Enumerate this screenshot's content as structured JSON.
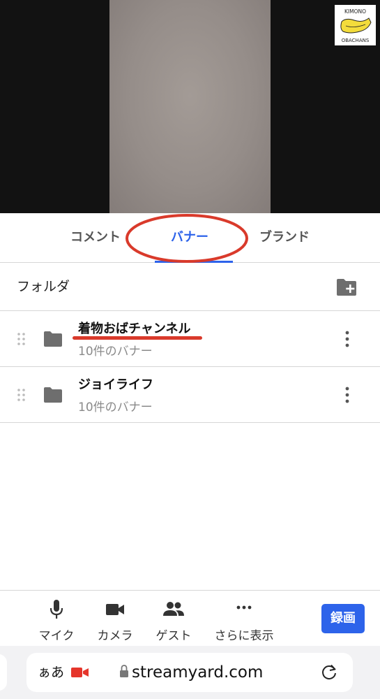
{
  "logo": {
    "line1": "KIMONO",
    "line2": "OBACHANS"
  },
  "tabs": [
    {
      "label": "コメント",
      "active": false
    },
    {
      "label": "バナー",
      "active": true
    },
    {
      "label": "ブランド",
      "active": false
    }
  ],
  "folders": {
    "title": "フォルダ",
    "items": [
      {
        "name": "着物おばチャンネル",
        "sub": "10件のバナー"
      },
      {
        "name": "ジョイライフ",
        "sub": "10件のバナー"
      }
    ]
  },
  "toolbar": {
    "mic": "マイク",
    "camera": "カメラ",
    "guest": "ゲスト",
    "more": "さらに表示",
    "record": "録画"
  },
  "browser": {
    "aa": "ぁあ",
    "url": "streamyard.com"
  },
  "colors": {
    "accent": "#2d63ea",
    "annotation_red": "#d93a2b",
    "recording_red": "#e5352b"
  }
}
